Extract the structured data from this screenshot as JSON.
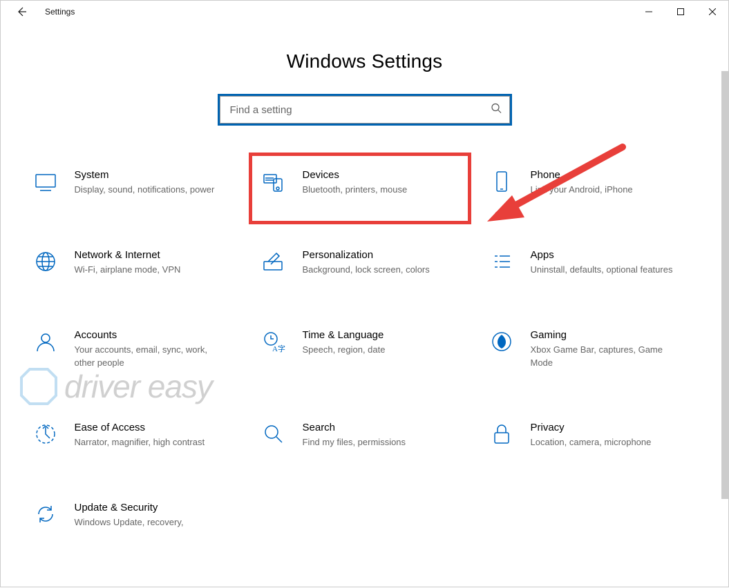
{
  "window": {
    "title": "Settings"
  },
  "header": {
    "page_title": "Windows Settings"
  },
  "search": {
    "placeholder": "Find a setting"
  },
  "tiles": [
    {
      "key": "system",
      "title": "System",
      "desc": "Display, sound, notifications, power"
    },
    {
      "key": "devices",
      "title": "Devices",
      "desc": "Bluetooth, printers, mouse",
      "highlight": true
    },
    {
      "key": "phone",
      "title": "Phone",
      "desc": "Link your Android, iPhone"
    },
    {
      "key": "network",
      "title": "Network & Internet",
      "desc": "Wi-Fi, airplane mode, VPN"
    },
    {
      "key": "personalization",
      "title": "Personalization",
      "desc": "Background, lock screen, colors"
    },
    {
      "key": "apps",
      "title": "Apps",
      "desc": "Uninstall, defaults, optional features"
    },
    {
      "key": "accounts",
      "title": "Accounts",
      "desc": "Your accounts, email, sync, work, other people"
    },
    {
      "key": "time",
      "title": "Time & Language",
      "desc": "Speech, region, date"
    },
    {
      "key": "gaming",
      "title": "Gaming",
      "desc": "Xbox Game Bar, captures, Game Mode"
    },
    {
      "key": "ease",
      "title": "Ease of Access",
      "desc": "Narrator, magnifier, high contrast"
    },
    {
      "key": "search",
      "title": "Search",
      "desc": "Find my files, permissions"
    },
    {
      "key": "privacy",
      "title": "Privacy",
      "desc": "Location, camera, microphone"
    },
    {
      "key": "update",
      "title": "Update & Security",
      "desc": "Windows Update, recovery,"
    }
  ],
  "watermark": {
    "text": "driver easy"
  },
  "colors": {
    "accent": "#0067c0",
    "highlight_border": "#e83f3a",
    "search_border": "#0063b1"
  }
}
